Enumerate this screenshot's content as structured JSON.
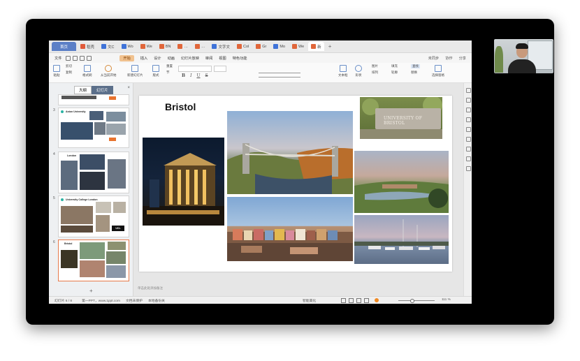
{
  "tabs": {
    "home": "首页",
    "items": [
      {
        "label": "稻壳",
        "color": "#e05a3a"
      },
      {
        "label": "文C",
        "color": "#3f73d8"
      },
      {
        "label": "Wo",
        "color": "#3f73d8"
      },
      {
        "label": "We",
        "color": "#e0663a"
      },
      {
        "label": "BN",
        "color": "#e0663a"
      },
      {
        "label": "…",
        "color": "#e0663a"
      },
      {
        "label": "…",
        "color": "#e0663a"
      },
      {
        "label": "文字文",
        "color": "#3f73d8"
      },
      {
        "label": "Col",
        "color": "#e0663a"
      },
      {
        "label": "Gr",
        "color": "#e0663a"
      },
      {
        "label": "Mo",
        "color": "#3f73d8"
      },
      {
        "label": "We",
        "color": "#e0663a"
      },
      {
        "label": "新",
        "color": "#e0663a"
      }
    ],
    "plus": "+"
  },
  "menu": {
    "file": "文件",
    "start": "开始",
    "insert": "插入",
    "design": "设计",
    "animation": "动画",
    "slideshow": "幻灯片放映",
    "review": "审阅",
    "view": "视图",
    "special": "特色功能",
    "collab": "未同步",
    "share_label": "协作",
    "share": "分享"
  },
  "ribbon": {
    "paste": "粘贴",
    "cut": "剪切",
    "copy": "复制",
    "format_painter": "格式刷",
    "from_current": "从当前开始",
    "new_slide": "新建幻灯片",
    "layout": "版式",
    "section": "节",
    "reset": "重置",
    "textbox": "文本框",
    "shape": "形状",
    "arrange": "排列",
    "picture": "图片",
    "fill": "填充",
    "outline": "轮廓",
    "find": "查找",
    "replace": "替换",
    "select_pane": "选择窗格"
  },
  "panel": {
    "outline_tab": "大纲",
    "slides_tab": "幻灯片",
    "close": "×",
    "add": "+",
    "slides": [
      {
        "num": "3",
        "title": "Aston University"
      },
      {
        "num": "4",
        "title": "London"
      },
      {
        "num": "5",
        "title": "University College London"
      },
      {
        "num": "6",
        "title": "Bristol"
      }
    ],
    "aston_logo": "Aston University",
    "ucl_logo": "UCL"
  },
  "slide": {
    "title": "Bristol",
    "sign_text": "UNIVERSITY OF BRISTOL"
  },
  "notes_placeholder": "单击此处添加备注",
  "status": {
    "slide_count": "幻灯片 6 / 8",
    "theme": "第一PPT，www.1ppt.com",
    "doc_protect": "文档未保护",
    "font_missing": "本地备份关",
    "smart_beautify": "智能美化",
    "zoom": "111 %"
  }
}
